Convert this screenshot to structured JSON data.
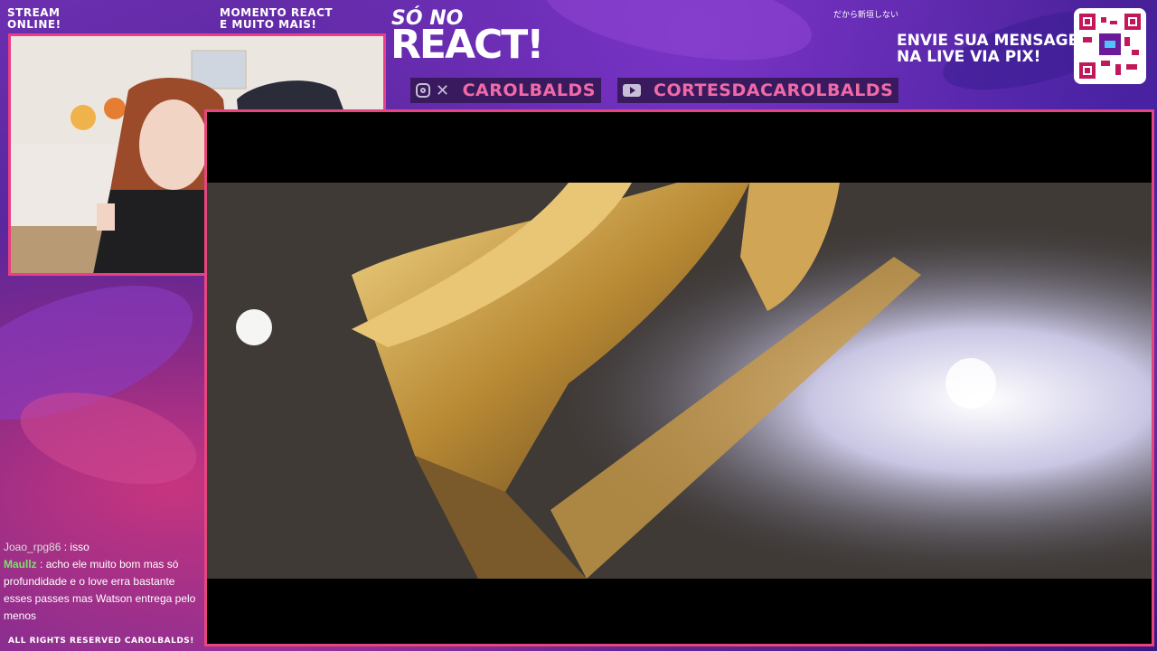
{
  "overlay": {
    "stream_status": [
      "STREAM",
      "ONLINE!"
    ],
    "momento": [
      "MOMENTO REACT",
      "E MUITO MAIS!"
    ],
    "title_small": "SÓ NO",
    "title_big": "REACT!",
    "japanese_text": "だから新垣しない",
    "socials": [
      {
        "icons": "instagram-x",
        "handle": "CAROLBALDS"
      },
      {
        "icons": "youtube",
        "handle": "CORTESDACAROLBALDS"
      }
    ],
    "pix_message": [
      "ENVIE SUA MENSAGEM",
      "NA LIVE VIA PIX!"
    ],
    "footer": "ALL RIGHTS RESERVED CAROLBALDS!"
  },
  "chat": [
    {
      "user": "Joao_rpg86",
      "message": "isso"
    },
    {
      "user": "Maullz",
      "message": "acho ele muito bom mas só profundidade e o love erra bastante esses passes mas Watson entrega pelo menos"
    }
  ],
  "colors": {
    "accent_pink": "#ea3f84",
    "chat_user_green": "#7ee06b",
    "social_text": "#f06aa8"
  }
}
